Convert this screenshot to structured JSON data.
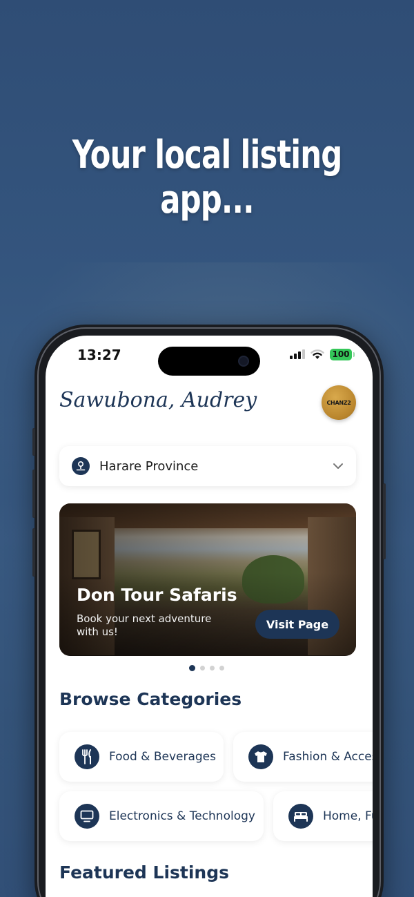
{
  "headline": "Your local listing app...",
  "status_bar": {
    "time": "13:27",
    "battery": "100"
  },
  "greeting": "Sawubona, Audrey",
  "avatar": {
    "label": "CHANZ2",
    "icon": "user-avatar"
  },
  "location": {
    "label": "Harare Province",
    "icon": "location-pin-icon",
    "chevron": "chevron-down-icon"
  },
  "hero": {
    "title": "Don Tour Safaris",
    "subtitle": "Book your next adventure with us!",
    "button": "Visit Page",
    "slides": 4,
    "active_slide": 1
  },
  "categories": {
    "title": "Browse Categories",
    "items": [
      {
        "label": "Food & Beverages",
        "icon": "utensils-icon"
      },
      {
        "label": "Fashion & Acces",
        "icon": "tshirt-icon"
      },
      {
        "label": "Electronics & Technology",
        "icon": "monitor-icon"
      },
      {
        "label": "Home, Fu",
        "icon": "bed-icon"
      }
    ]
  },
  "featured": {
    "title": "Featured Listings"
  },
  "colors": {
    "primary": "#1d3556",
    "background": "#34557e",
    "battery": "#34c759"
  }
}
